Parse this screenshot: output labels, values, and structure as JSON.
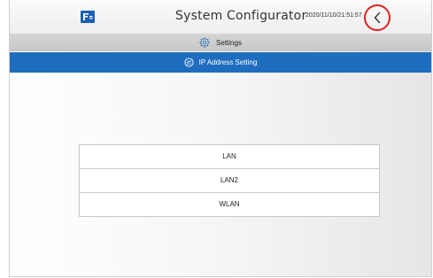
{
  "header": {
    "logo_icon": "fe-logo-icon",
    "title": "System Configurator",
    "datetime": "2020/11/10/21:51:57",
    "back_icon": "chevron-left-icon",
    "highlight_color": "#e02020"
  },
  "settings_bar": {
    "icon": "gear-icon",
    "label": "Settings"
  },
  "ip_bar": {
    "icon": "network-icon",
    "label": "IP Address Setting",
    "color": "#1f6dbf"
  },
  "menu": {
    "items": [
      {
        "label": "LAN"
      },
      {
        "label": "LAN2"
      },
      {
        "label": "WLAN"
      }
    ]
  }
}
